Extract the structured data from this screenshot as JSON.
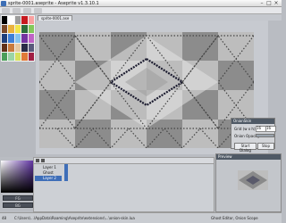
{
  "window": {
    "title": "sprite-0001.aseprite - Aseprite v1.3.10.1"
  },
  "tabs": {
    "active": "sprite-0001.ase"
  },
  "palette": {
    "colors": [
      "#000000",
      "#ffffff",
      "#9c9c9c",
      "#c7191f",
      "#f8a0a0",
      "#7b4a2a",
      "#eab23d",
      "#f2e64b",
      "#2d6f3a",
      "#83c95a",
      "#1e3f7b",
      "#3e7fd8",
      "#84c3f0",
      "#7433a0",
      "#c062c6",
      "#603018",
      "#c87a3c",
      "#e6c9a2",
      "#2a2a46",
      "#5a5a7c",
      "#4a9e5a",
      "#9bd4a6",
      "#d8e05c",
      "#e07a38",
      "#a01e44"
    ]
  },
  "color_bar": {
    "fg_label": "FG",
    "bg_label": "BG"
  },
  "onion": {
    "title": "OnionSkin",
    "grid_label": "Grid (w x h)",
    "grid_w": "16",
    "grid_h": "16",
    "opacity_label": "Onion Opacity",
    "start_btn": "Start Dialog",
    "stop_btn": "Stop"
  },
  "timeline": {
    "layers": [
      "Layer 1",
      "Ghost",
      "Layer 2"
    ],
    "selected_layer_index": 2
  },
  "preview": {
    "title": "Preview"
  },
  "status": {
    "frame": "48",
    "path": "C:\\Users\\...\\AppData\\Roaming\\Aseprite\\extensions\\...\\onion-skin.lua",
    "right": "Ghost Editor, Onion Scope"
  }
}
